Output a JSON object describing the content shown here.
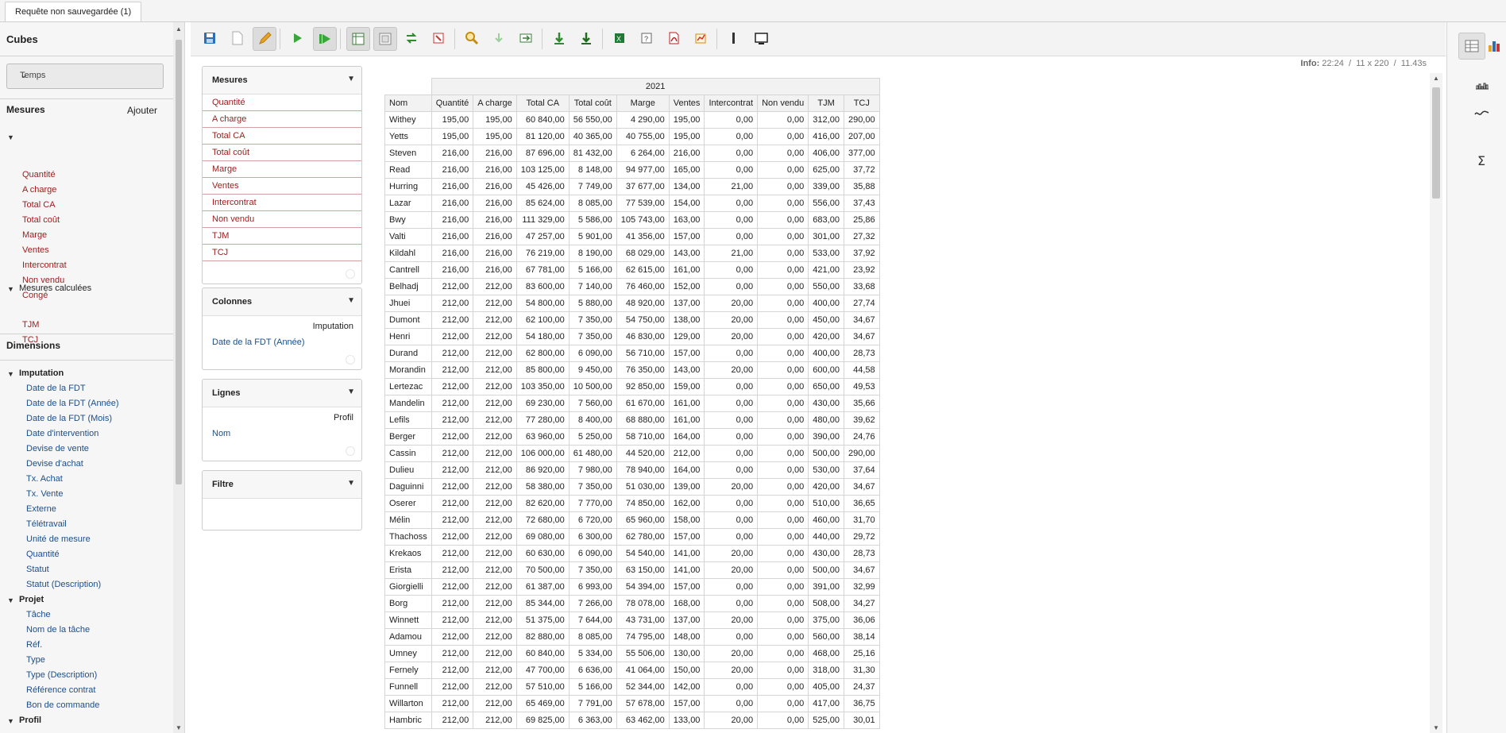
{
  "tab": {
    "title": "Requête non sauvegardée (1)"
  },
  "left_panel": {
    "cubes_title": "Cubes",
    "cube_selected": "Temps",
    "mesures_title": "Mesures",
    "add_label": "Ajouter",
    "measures": [
      "Quantité",
      "A charge",
      "Total CA",
      "Total coût",
      "Marge",
      "Ventes",
      "Intercontrat",
      "Non vendu",
      "Congé"
    ],
    "calc_group": "Mesures calculées",
    "calc_measures": [
      "TJM",
      "TCJ"
    ],
    "dimensions_title": "Dimensions",
    "dim_groups": [
      {
        "name": "Imputation",
        "items": [
          "Date de la FDT",
          "Date de la FDT (Année)",
          "Date de la FDT (Mois)",
          "Date d'intervention",
          "Devise de vente",
          "Devise d'achat",
          "Tx. Achat",
          "Tx. Vente",
          "Externe",
          "Télétravail",
          "Unité de mesure",
          "Quantité",
          "Statut",
          "Statut (Description)"
        ]
      },
      {
        "name": "Projet",
        "items": [
          "Tâche",
          "Nom de la tâche",
          "Réf.",
          "Type",
          "Type (Description)",
          "Référence contrat",
          "Bon de commande"
        ]
      },
      {
        "name": "Profil",
        "items": []
      }
    ]
  },
  "toolbar": {
    "icons": [
      "save-icon",
      "new-query-icon",
      "edit-icon",
      "run-icon",
      "auto-run-icon",
      "toggle-fields-icon",
      "toggle-sidebar-icon",
      "swap-axis-icon",
      "non-empty-icon",
      "zoom-icon",
      "drill-icon",
      "drill-across-icon",
      "export-xls-icon",
      "export-csv-icon",
      "export-excel-icon",
      "mdx-icon",
      "export-pdf-icon",
      "chart-icon",
      "separator-icon",
      "fullscreen-icon"
    ]
  },
  "query_panels": {
    "mesures": {
      "title": "Mesures",
      "items": [
        "Quantité",
        "A charge",
        "Total CA",
        "Total coût",
        "Marge",
        "Ventes",
        "Intercontrat",
        "Non vendu",
        "TJM",
        "TCJ"
      ]
    },
    "colonnes": {
      "title": "Colonnes",
      "hierarchy": "Imputation",
      "level": "Date de la FDT (Année)"
    },
    "lignes": {
      "title": "Lignes",
      "hierarchy": "Profil",
      "level": "Nom"
    },
    "filtre": {
      "title": "Filtre"
    }
  },
  "info": {
    "label": "Info:",
    "time": "22:24",
    "dims": "11 x 220",
    "duration": "11.43s"
  },
  "grid": {
    "year": "2021",
    "name_header": "Nom",
    "columns": [
      "Quantité",
      "A charge",
      "Total CA",
      "Total coût",
      "Marge",
      "Ventes",
      "Intercontrat",
      "Non vendu",
      "TJM",
      "TCJ"
    ],
    "rows": [
      [
        "Withey",
        "195,00",
        "195,00",
        "60 840,00",
        "56 550,00",
        "4 290,00",
        "195,00",
        "0,00",
        "0,00",
        "312,00",
        "290,00"
      ],
      [
        "Yetts",
        "195,00",
        "195,00",
        "81 120,00",
        "40 365,00",
        "40 755,00",
        "195,00",
        "0,00",
        "0,00",
        "416,00",
        "207,00"
      ],
      [
        "Steven",
        "216,00",
        "216,00",
        "87 696,00",
        "81 432,00",
        "6 264,00",
        "216,00",
        "0,00",
        "0,00",
        "406,00",
        "377,00"
      ],
      [
        "Read",
        "216,00",
        "216,00",
        "103 125,00",
        "8 148,00",
        "94 977,00",
        "165,00",
        "0,00",
        "0,00",
        "625,00",
        "37,72"
      ],
      [
        "Hurring",
        "216,00",
        "216,00",
        "45 426,00",
        "7 749,00",
        "37 677,00",
        "134,00",
        "21,00",
        "0,00",
        "339,00",
        "35,88"
      ],
      [
        "Lazar",
        "216,00",
        "216,00",
        "85 624,00",
        "8 085,00",
        "77 539,00",
        "154,00",
        "0,00",
        "0,00",
        "556,00",
        "37,43"
      ],
      [
        "Bwy",
        "216,00",
        "216,00",
        "111 329,00",
        "5 586,00",
        "105 743,00",
        "163,00",
        "0,00",
        "0,00",
        "683,00",
        "25,86"
      ],
      [
        "Valti",
        "216,00",
        "216,00",
        "47 257,00",
        "5 901,00",
        "41 356,00",
        "157,00",
        "0,00",
        "0,00",
        "301,00",
        "27,32"
      ],
      [
        "Kildahl",
        "216,00",
        "216,00",
        "76 219,00",
        "8 190,00",
        "68 029,00",
        "143,00",
        "21,00",
        "0,00",
        "533,00",
        "37,92"
      ],
      [
        "Cantrell",
        "216,00",
        "216,00",
        "67 781,00",
        "5 166,00",
        "62 615,00",
        "161,00",
        "0,00",
        "0,00",
        "421,00",
        "23,92"
      ],
      [
        "Belhadj",
        "212,00",
        "212,00",
        "83 600,00",
        "7 140,00",
        "76 460,00",
        "152,00",
        "0,00",
        "0,00",
        "550,00",
        "33,68"
      ],
      [
        "Jhuei",
        "212,00",
        "212,00",
        "54 800,00",
        "5 880,00",
        "48 920,00",
        "137,00",
        "20,00",
        "0,00",
        "400,00",
        "27,74"
      ],
      [
        "Dumont",
        "212,00",
        "212,00",
        "62 100,00",
        "7 350,00",
        "54 750,00",
        "138,00",
        "20,00",
        "0,00",
        "450,00",
        "34,67"
      ],
      [
        "Henri",
        "212,00",
        "212,00",
        "54 180,00",
        "7 350,00",
        "46 830,00",
        "129,00",
        "20,00",
        "0,00",
        "420,00",
        "34,67"
      ],
      [
        "Durand",
        "212,00",
        "212,00",
        "62 800,00",
        "6 090,00",
        "56 710,00",
        "157,00",
        "0,00",
        "0,00",
        "400,00",
        "28,73"
      ],
      [
        "Morandin",
        "212,00",
        "212,00",
        "85 800,00",
        "9 450,00",
        "76 350,00",
        "143,00",
        "20,00",
        "0,00",
        "600,00",
        "44,58"
      ],
      [
        "Lertezac",
        "212,00",
        "212,00",
        "103 350,00",
        "10 500,00",
        "92 850,00",
        "159,00",
        "0,00",
        "0,00",
        "650,00",
        "49,53"
      ],
      [
        "Mandelin",
        "212,00",
        "212,00",
        "69 230,00",
        "7 560,00",
        "61 670,00",
        "161,00",
        "0,00",
        "0,00",
        "430,00",
        "35,66"
      ],
      [
        "Lefils",
        "212,00",
        "212,00",
        "77 280,00",
        "8 400,00",
        "68 880,00",
        "161,00",
        "0,00",
        "0,00",
        "480,00",
        "39,62"
      ],
      [
        "Berger",
        "212,00",
        "212,00",
        "63 960,00",
        "5 250,00",
        "58 710,00",
        "164,00",
        "0,00",
        "0,00",
        "390,00",
        "24,76"
      ],
      [
        "Cassin",
        "212,00",
        "212,00",
        "106 000,00",
        "61 480,00",
        "44 520,00",
        "212,00",
        "0,00",
        "0,00",
        "500,00",
        "290,00"
      ],
      [
        "Dulieu",
        "212,00",
        "212,00",
        "86 920,00",
        "7 980,00",
        "78 940,00",
        "164,00",
        "0,00",
        "0,00",
        "530,00",
        "37,64"
      ],
      [
        "Daguinni",
        "212,00",
        "212,00",
        "58 380,00",
        "7 350,00",
        "51 030,00",
        "139,00",
        "20,00",
        "0,00",
        "420,00",
        "34,67"
      ],
      [
        "Oserer",
        "212,00",
        "212,00",
        "82 620,00",
        "7 770,00",
        "74 850,00",
        "162,00",
        "0,00",
        "0,00",
        "510,00",
        "36,65"
      ],
      [
        "Mélin",
        "212,00",
        "212,00",
        "72 680,00",
        "6 720,00",
        "65 960,00",
        "158,00",
        "0,00",
        "0,00",
        "460,00",
        "31,70"
      ],
      [
        "Thachoss",
        "212,00",
        "212,00",
        "69 080,00",
        "6 300,00",
        "62 780,00",
        "157,00",
        "0,00",
        "0,00",
        "440,00",
        "29,72"
      ],
      [
        "Krekaos",
        "212,00",
        "212,00",
        "60 630,00",
        "6 090,00",
        "54 540,00",
        "141,00",
        "20,00",
        "0,00",
        "430,00",
        "28,73"
      ],
      [
        "Erista",
        "212,00",
        "212,00",
        "70 500,00",
        "7 350,00",
        "63 150,00",
        "141,00",
        "20,00",
        "0,00",
        "500,00",
        "34,67"
      ],
      [
        "Giorgielli",
        "212,00",
        "212,00",
        "61 387,00",
        "6 993,00",
        "54 394,00",
        "157,00",
        "0,00",
        "0,00",
        "391,00",
        "32,99"
      ],
      [
        "Borg",
        "212,00",
        "212,00",
        "85 344,00",
        "7 266,00",
        "78 078,00",
        "168,00",
        "0,00",
        "0,00",
        "508,00",
        "34,27"
      ],
      [
        "Winnett",
        "212,00",
        "212,00",
        "51 375,00",
        "7 644,00",
        "43 731,00",
        "137,00",
        "20,00",
        "0,00",
        "375,00",
        "36,06"
      ],
      [
        "Adamou",
        "212,00",
        "212,00",
        "82 880,00",
        "8 085,00",
        "74 795,00",
        "148,00",
        "0,00",
        "0,00",
        "560,00",
        "38,14"
      ],
      [
        "Umney",
        "212,00",
        "212,00",
        "60 840,00",
        "5 334,00",
        "55 506,00",
        "130,00",
        "20,00",
        "0,00",
        "468,00",
        "25,16"
      ],
      [
        "Fernely",
        "212,00",
        "212,00",
        "47 700,00",
        "6 636,00",
        "41 064,00",
        "150,00",
        "20,00",
        "0,00",
        "318,00",
        "31,30"
      ],
      [
        "Funnell",
        "212,00",
        "212,00",
        "57 510,00",
        "5 166,00",
        "52 344,00",
        "142,00",
        "0,00",
        "0,00",
        "405,00",
        "24,37"
      ],
      [
        "Willarton",
        "212,00",
        "212,00",
        "65 469,00",
        "7 791,00",
        "57 678,00",
        "157,00",
        "0,00",
        "0,00",
        "417,00",
        "36,75"
      ],
      [
        "Hambric",
        "212,00",
        "212,00",
        "69 825,00",
        "6 363,00",
        "63 462,00",
        "133,00",
        "20,00",
        "0,00",
        "525,00",
        "30,01"
      ]
    ]
  },
  "right_panel": {
    "icons": [
      "table-view-icon",
      "chart-view-icon",
      "bar-chart-icon",
      "line-chart-icon",
      "sum-icon"
    ]
  }
}
